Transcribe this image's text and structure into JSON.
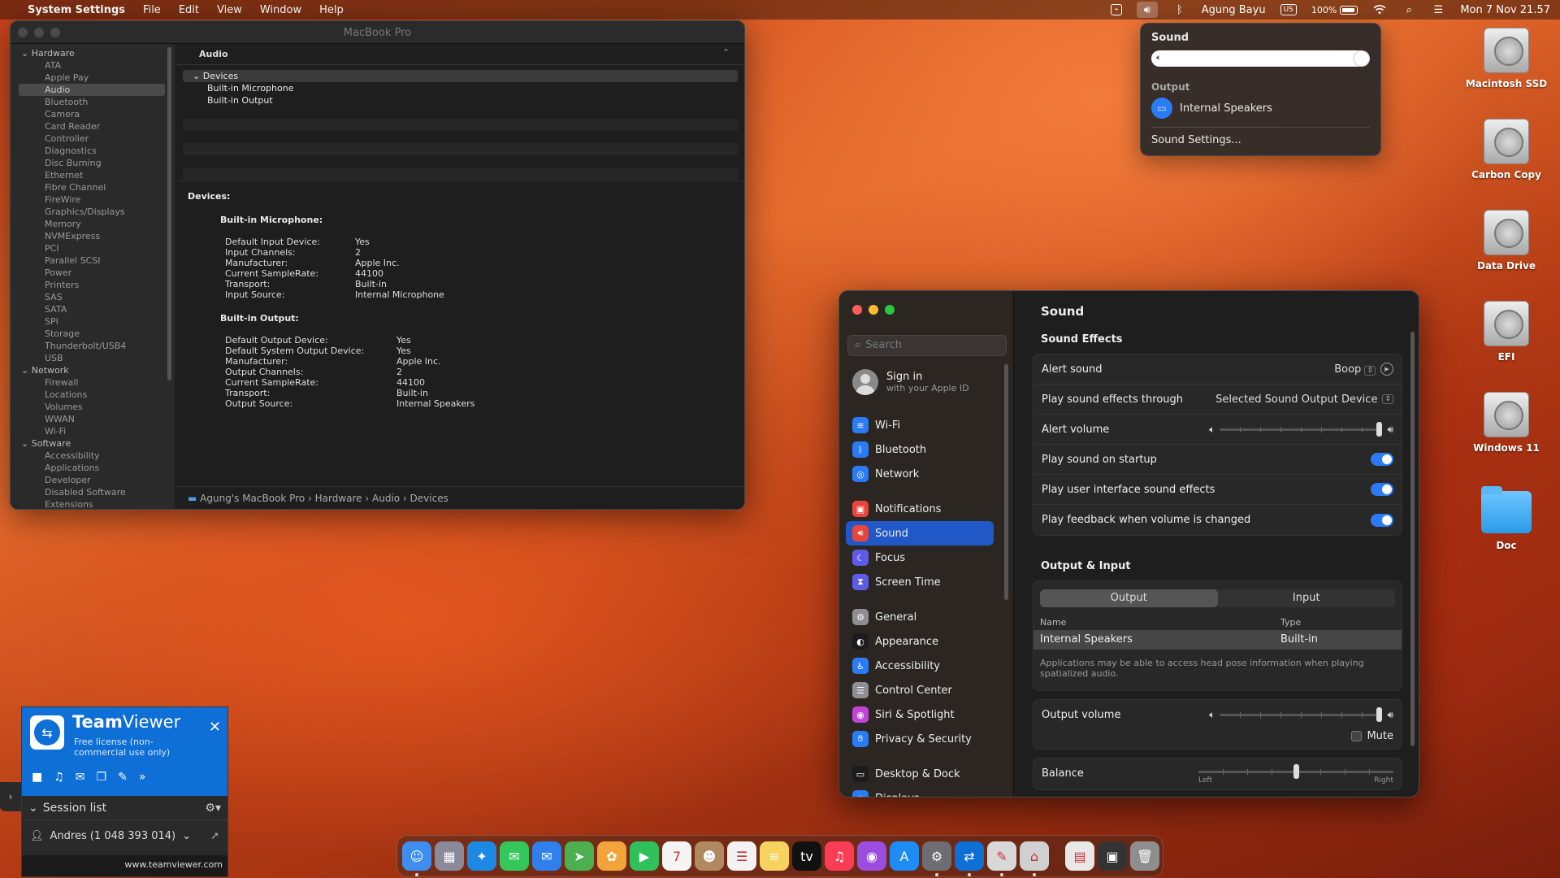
{
  "menubar": {
    "apple_glyph": "",
    "app_name": "System Settings",
    "menus": [
      "File",
      "Edit",
      "View",
      "Window",
      "Help"
    ],
    "user": "Agung Bayu",
    "input_source": "US",
    "battery": "100%",
    "datetime": "Mon 7 Nov  21.57"
  },
  "sound_popover": {
    "title": "Sound",
    "volume_level": 1.0,
    "output_label": "Output",
    "output_device": "Internal Speakers",
    "settings_link": "Sound Settings..."
  },
  "desktop_icons": [
    "Macintosh SSD",
    "Carbon Copy",
    "Data Drive",
    "EFI",
    "Windows 11",
    "Doc"
  ],
  "system_info": {
    "title": "MacBook Pro",
    "sidebar": [
      {
        "group": "Hardware",
        "items": [
          "ATA",
          "Apple Pay",
          "Audio",
          "Bluetooth",
          "Camera",
          "Card Reader",
          "Controller",
          "Diagnostics",
          "Disc Burning",
          "Ethernet",
          "Fibre Channel",
          "FireWire",
          "Graphics/Displays",
          "Memory",
          "NVMExpress",
          "PCI",
          "Parallel SCSI",
          "Power",
          "Printers",
          "SAS",
          "SATA",
          "SPI",
          "Storage",
          "Thunderbolt/USB4",
          "USB"
        ]
      },
      {
        "group": "Network",
        "items": [
          "Firewall",
          "Locations",
          "Volumes",
          "WWAN",
          "Wi-Fi"
        ]
      },
      {
        "group": "Software",
        "items": [
          "Accessibility",
          "Applications",
          "Developer",
          "Disabled Software",
          "Extensions"
        ]
      }
    ],
    "selected_item": "Audio",
    "header": "Audio",
    "tree_root": "Devices",
    "tree_children": [
      "Built-in Microphone",
      "Built-in Output"
    ],
    "detail_heading": "Devices:",
    "mic_heading": "Built-in Microphone:",
    "mic_fields": [
      [
        "Default Input Device:",
        "Yes"
      ],
      [
        "Input Channels:",
        "2"
      ],
      [
        "Manufacturer:",
        "Apple Inc."
      ],
      [
        "Current SampleRate:",
        "44100"
      ],
      [
        "Transport:",
        "Built-in"
      ],
      [
        "Input Source:",
        "Internal Microphone"
      ]
    ],
    "out_heading": "Built-in Output:",
    "out_fields": [
      [
        "Default Output Device:",
        "Yes"
      ],
      [
        "Default System Output Device:",
        "Yes"
      ],
      [
        "Manufacturer:",
        "Apple Inc."
      ],
      [
        "Output Channels:",
        "2"
      ],
      [
        "Current SampleRate:",
        "44100"
      ],
      [
        "Transport:",
        "Built-in"
      ],
      [
        "Output Source:",
        "Internal Speakers"
      ]
    ],
    "path": "Agung's MacBook Pro  ›  Hardware  ›  Audio  ›  Devices"
  },
  "settings": {
    "search_placeholder": "Search",
    "signin": "Sign in",
    "signin_sub": "with your Apple ID",
    "nav_groups": [
      [
        {
          "label": "Wi-Fi",
          "icon": "wifi-icon",
          "color": "#2a7bf6"
        },
        {
          "label": "Bluetooth",
          "icon": "bluetooth-icon",
          "color": "#2a7bf6"
        },
        {
          "label": "Network",
          "icon": "network-icon",
          "color": "#2a7bf6"
        }
      ],
      [
        {
          "label": "Notifications",
          "icon": "notifications-icon",
          "color": "#e8463c"
        },
        {
          "label": "Sound",
          "icon": "sound-icon",
          "color": "#e8463c"
        },
        {
          "label": "Focus",
          "icon": "focus-icon",
          "color": "#5e5ce6"
        },
        {
          "label": "Screen Time",
          "icon": "screen-time-icon",
          "color": "#5e5ce6"
        }
      ],
      [
        {
          "label": "General",
          "icon": "general-icon",
          "color": "#8e8e93"
        },
        {
          "label": "Appearance",
          "icon": "appearance-icon",
          "color": "#1c1c1e"
        },
        {
          "label": "Accessibility",
          "icon": "accessibility-icon",
          "color": "#2a7bf6"
        },
        {
          "label": "Control Center",
          "icon": "control-center-icon",
          "color": "#8e8e93"
        },
        {
          "label": "Siri & Spotlight",
          "icon": "siri-icon",
          "color": "#c044d8"
        },
        {
          "label": "Privacy & Security",
          "icon": "privacy-icon",
          "color": "#2a7bf6"
        }
      ],
      [
        {
          "label": "Desktop & Dock",
          "icon": "desktop-dock-icon",
          "color": "#1c1c1e"
        },
        {
          "label": "Displays",
          "icon": "displays-icon",
          "color": "#2a7bf6"
        }
      ]
    ],
    "selected": "Sound",
    "title": "Sound",
    "effects_heading": "Sound Effects",
    "alert_sound_label": "Alert sound",
    "alert_sound_value": "Boop",
    "play_through_label": "Play sound effects through",
    "play_through_value": "Selected Sound Output Device",
    "alert_volume_label": "Alert volume",
    "alert_volume_level": 1.0,
    "startup_label": "Play sound on startup",
    "ui_effects_label": "Play user interface sound effects",
    "feedback_label": "Play feedback when volume is changed",
    "toggles": {
      "startup": true,
      "ui_effects": true,
      "feedback": true
    },
    "io_heading": "Output & Input",
    "tabs": [
      "Output",
      "Input"
    ],
    "active_tab": "Output",
    "col_name": "Name",
    "col_type": "Type",
    "device_name": "Internal Speakers",
    "device_type": "Built-in",
    "note": "Applications may be able to access head pose information when playing spatialized audio.",
    "output_volume_label": "Output volume",
    "output_volume_level": 1.0,
    "mute_label": "Mute",
    "mute": false,
    "balance_label": "Balance",
    "balance_left": "Left",
    "balance_right": "Right",
    "balance_level": 0.5
  },
  "teamviewer": {
    "brand_a": "Team",
    "brand_b": "Viewer",
    "license": "Free license (non-commercial use only)",
    "session_list": "Session list",
    "contact": "Andres (1 048 393 014)",
    "site": "www.teamviewer.com"
  },
  "dock": [
    {
      "name": "finder",
      "icon": "finder-icon",
      "color": "#3d8ef0",
      "glyph": "☺",
      "running": true
    },
    {
      "name": "launchpad",
      "icon": "launchpad-icon",
      "color": "#8a8a9a",
      "glyph": "▦",
      "running": false
    },
    {
      "name": "safari",
      "icon": "safari-icon",
      "color": "#1e88e5",
      "glyph": "✦",
      "running": false
    },
    {
      "name": "messages",
      "icon": "messages-icon",
      "color": "#34c759",
      "glyph": "✉",
      "running": false
    },
    {
      "name": "mail",
      "icon": "mail-icon",
      "color": "#2f80ed",
      "glyph": "✉",
      "running": false
    },
    {
      "name": "maps",
      "icon": "maps-icon",
      "color": "#4caf50",
      "glyph": "➤",
      "running": false
    },
    {
      "name": "photos",
      "icon": "photos-icon",
      "color": "#f2a33a",
      "glyph": "✿",
      "running": false
    },
    {
      "name": "facetime",
      "icon": "facetime-icon",
      "color": "#30c15a",
      "glyph": "▶",
      "running": false
    },
    {
      "name": "calendar",
      "icon": "calendar-icon",
      "color": "#f5f5f5",
      "glyph": "7",
      "running": false
    },
    {
      "name": "contacts",
      "icon": "contacts-icon",
      "color": "#b08960",
      "glyph": "☻",
      "running": false
    },
    {
      "name": "reminders",
      "icon": "reminders-icon",
      "color": "#f2f2f2",
      "glyph": "☰",
      "running": false
    },
    {
      "name": "notes",
      "icon": "notes-icon",
      "color": "#f6d35e",
      "glyph": "≡",
      "running": false
    },
    {
      "name": "tv",
      "icon": "tv-icon",
      "color": "#111111",
      "glyph": "tv",
      "running": false
    },
    {
      "name": "music",
      "icon": "music-icon",
      "color": "#fa3c55",
      "glyph": "♫",
      "running": false
    },
    {
      "name": "podcasts",
      "icon": "podcasts-icon",
      "color": "#9b4de0",
      "glyph": "◉",
      "running": false
    },
    {
      "name": "app-store",
      "icon": "app-store-icon",
      "color": "#1d8cf5",
      "glyph": "A",
      "running": false
    },
    {
      "name": "system-settings",
      "icon": "system-settings-icon",
      "color": "#6d6d72",
      "glyph": "⚙",
      "running": true
    },
    {
      "name": "teamviewer",
      "icon": "teamviewer-icon",
      "color": "#0e6fd6",
      "glyph": "⇄",
      "running": true
    },
    {
      "name": "script-editor",
      "icon": "script-editor-icon",
      "color": "#d8d8d8",
      "glyph": "✎",
      "running": true
    },
    {
      "name": "system-information",
      "icon": "system-information-icon",
      "color": "#d0d0d0",
      "glyph": "⌂",
      "running": true
    },
    {
      "name": "document",
      "icon": "document-icon",
      "color": "#e8e8e8",
      "glyph": "▤",
      "running": false
    },
    {
      "name": "screenshot",
      "icon": "screenshot-icon",
      "color": "#333333",
      "glyph": "▣",
      "running": false
    },
    {
      "name": "trash",
      "icon": "trash-icon",
      "color": "#8e8e8e",
      "glyph": "🗑",
      "running": false
    }
  ]
}
